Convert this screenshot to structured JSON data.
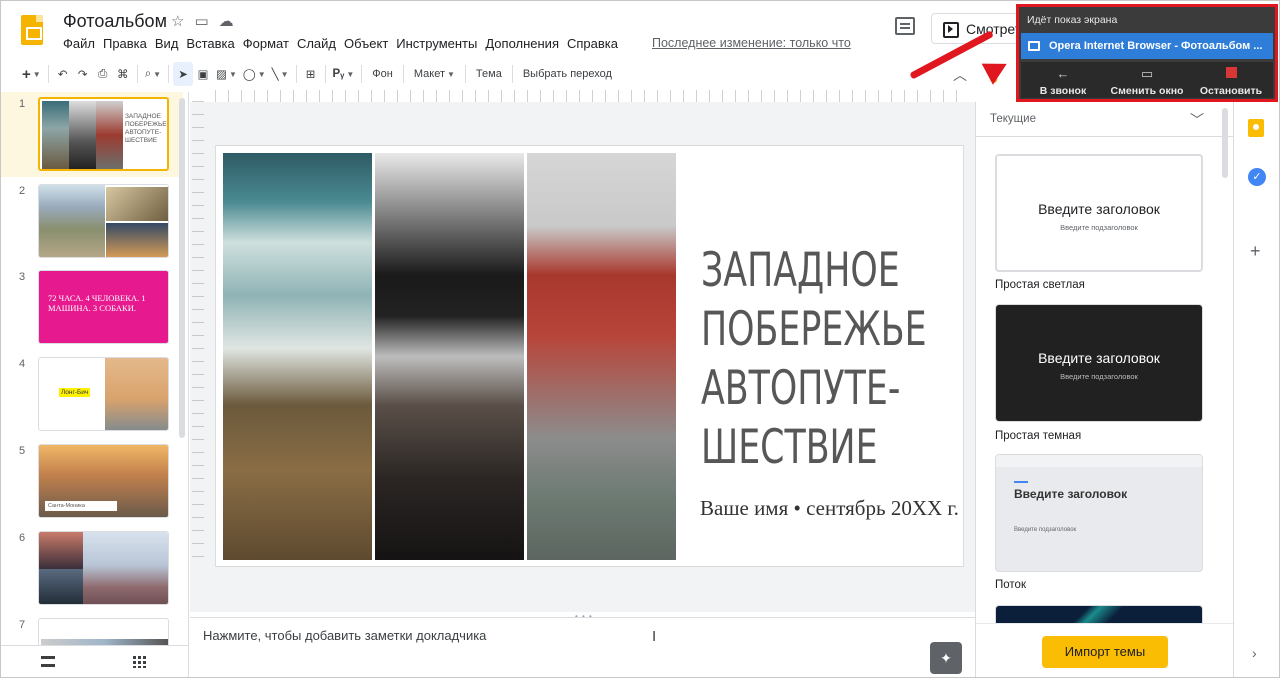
{
  "header": {
    "doc_title": "Фотоальбом",
    "menu": [
      "Файл",
      "Правка",
      "Вид",
      "Вставка",
      "Формат",
      "Слайд",
      "Объект",
      "Инструменты",
      "Дополнения",
      "Справка"
    ],
    "last_edit": "Последнее изменение: только что",
    "present_label": "Смотрет"
  },
  "toolbar": {
    "background": "Фон",
    "layout": "Макет",
    "theme": "Тема",
    "transition": "Выбрать переход"
  },
  "screen_share": {
    "title": "Идёт показ экрана",
    "tab": "Opera Internet Browser - Фотоальбом ...",
    "to_call": "В звонок",
    "change_window": "Сменить окно",
    "stop": "Остановить"
  },
  "filmstrip": {
    "numbers": [
      "1",
      "2",
      "3",
      "4",
      "5",
      "6",
      "7"
    ],
    "slide1_text": "ЗАПАДНОЕ ПОБЕРЕЖЬЕ АВТОПУТЕ-ШЕСТВИЕ",
    "slide3_text": "72 ЧАСА. 4 ЧЕЛОВЕКА. 1 МАШИНА. 3 СОБАКИ.",
    "slide4_text": "Лонг-Бич",
    "slide5_text": "Санта-Моника"
  },
  "slide": {
    "title_lines": [
      "ЗАПАДНОЕ",
      "ПОБЕРЕЖЬЕ",
      "АВТОПУТЕ-",
      "ШЕСТВИЕ"
    ],
    "subtitle": "Ваше имя • сентябрь 20XX г."
  },
  "notes": {
    "placeholder": "Нажмите, чтобы добавить заметки докладчика"
  },
  "themes": {
    "section": "Текущие",
    "card_title": "Введите заголовок",
    "card_subtitle": "Введите подзаголовок",
    "names": [
      "Простая светлая",
      "Простая темная",
      "Поток"
    ],
    "import_button": "Импорт темы"
  },
  "colors": {
    "accent": "#f4b400",
    "share_highlight": "#e0171e",
    "share_tab": "#2d7dd9",
    "pink_slide": "#e7198f"
  }
}
